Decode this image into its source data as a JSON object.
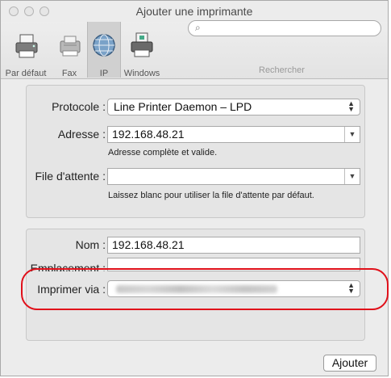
{
  "window": {
    "title": "Ajouter une imprimante"
  },
  "toolbar": {
    "items": [
      {
        "label": "Par défaut",
        "icon": "printer-default-icon"
      },
      {
        "label": "Fax",
        "icon": "fax-icon"
      },
      {
        "label": "IP",
        "icon": "globe-icon",
        "selected": true
      },
      {
        "label": "Windows",
        "icon": "windows-printer-icon"
      }
    ],
    "search_label": "Rechercher",
    "search_placeholder": ""
  },
  "form": {
    "protocol_label": "Protocole :",
    "protocol_value": "Line Printer Daemon – LPD",
    "address_label": "Adresse :",
    "address_value": "192.168.48.21",
    "address_hint": "Adresse complète et valide.",
    "queue_label": "File d'attente :",
    "queue_value": "",
    "queue_hint": "Laissez blanc pour utiliser la file d'attente par défaut."
  },
  "details": {
    "name_label": "Nom :",
    "name_value": "192.168.48.21",
    "location_label": "Emplacement :",
    "location_value": "",
    "print_via_label": "Imprimer via :"
  },
  "actions": {
    "add_label": "Ajouter"
  },
  "colors": {
    "highlight": "#e0101a",
    "window_bg": "#ececec"
  }
}
